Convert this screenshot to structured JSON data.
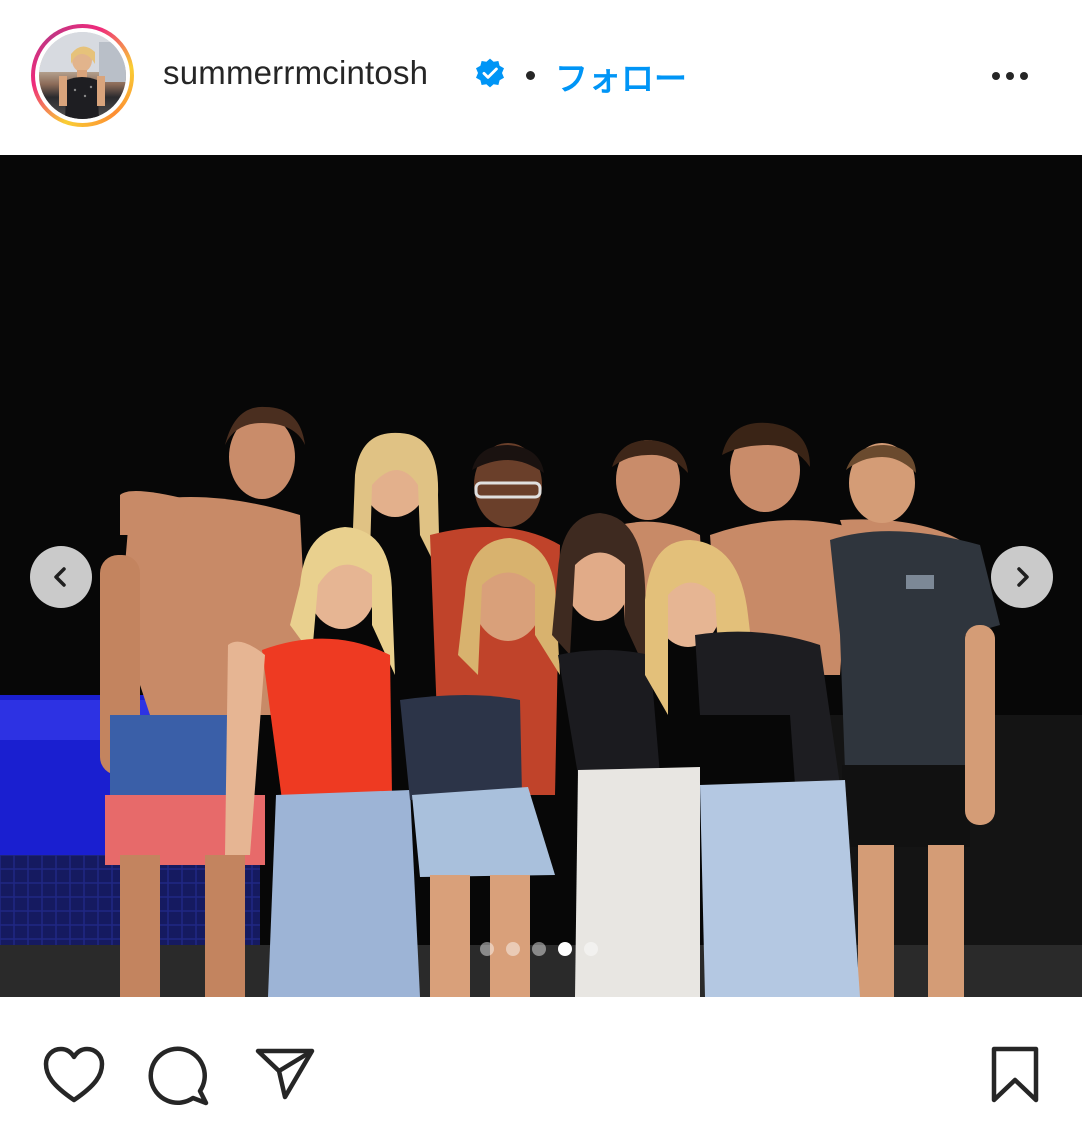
{
  "post": {
    "username": "summerrmcintosh",
    "verified": true,
    "follow_label": "フォロー",
    "separator": "•",
    "carousel": {
      "total_slides": 5,
      "active_slide": 4
    }
  },
  "icons": {
    "avatar": "avatar",
    "verified": "verified-badge-icon",
    "more": "more-options-icon",
    "prev": "chevron-left-icon",
    "next": "chevron-right-icon",
    "like": "heart-icon",
    "comment": "comment-bubble-icon",
    "share": "paper-plane-icon",
    "save": "bookmark-icon"
  },
  "colors": {
    "follow_blue": "#0095f6",
    "verified_blue": "#0095f6",
    "text": "#262626",
    "ring_start": "#f9ce34",
    "ring_mid": "#ee2a7b",
    "ring_end": "#c13584"
  }
}
